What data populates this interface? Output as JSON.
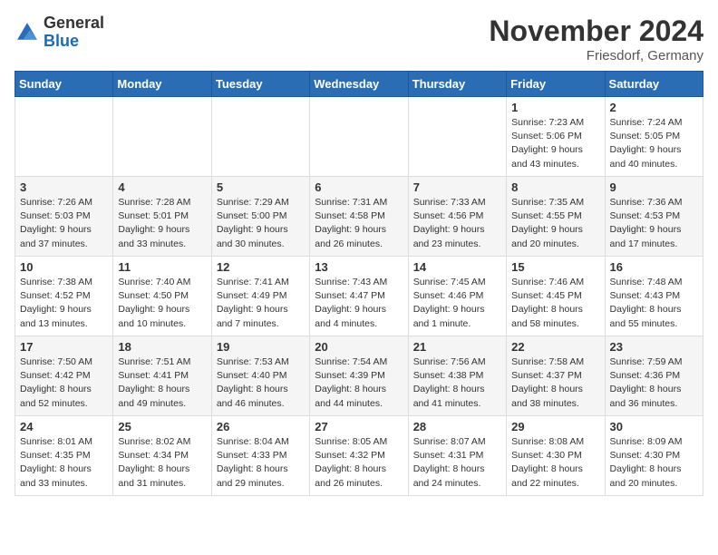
{
  "header": {
    "logo_general": "General",
    "logo_blue": "Blue",
    "month_title": "November 2024",
    "location": "Friesdorf, Germany"
  },
  "days_of_week": [
    "Sunday",
    "Monday",
    "Tuesday",
    "Wednesday",
    "Thursday",
    "Friday",
    "Saturday"
  ],
  "weeks": [
    [
      {
        "day": "",
        "info": ""
      },
      {
        "day": "",
        "info": ""
      },
      {
        "day": "",
        "info": ""
      },
      {
        "day": "",
        "info": ""
      },
      {
        "day": "",
        "info": ""
      },
      {
        "day": "1",
        "info": "Sunrise: 7:23 AM\nSunset: 5:06 PM\nDaylight: 9 hours\nand 43 minutes."
      },
      {
        "day": "2",
        "info": "Sunrise: 7:24 AM\nSunset: 5:05 PM\nDaylight: 9 hours\nand 40 minutes."
      }
    ],
    [
      {
        "day": "3",
        "info": "Sunrise: 7:26 AM\nSunset: 5:03 PM\nDaylight: 9 hours\nand 37 minutes."
      },
      {
        "day": "4",
        "info": "Sunrise: 7:28 AM\nSunset: 5:01 PM\nDaylight: 9 hours\nand 33 minutes."
      },
      {
        "day": "5",
        "info": "Sunrise: 7:29 AM\nSunset: 5:00 PM\nDaylight: 9 hours\nand 30 minutes."
      },
      {
        "day": "6",
        "info": "Sunrise: 7:31 AM\nSunset: 4:58 PM\nDaylight: 9 hours\nand 26 minutes."
      },
      {
        "day": "7",
        "info": "Sunrise: 7:33 AM\nSunset: 4:56 PM\nDaylight: 9 hours\nand 23 minutes."
      },
      {
        "day": "8",
        "info": "Sunrise: 7:35 AM\nSunset: 4:55 PM\nDaylight: 9 hours\nand 20 minutes."
      },
      {
        "day": "9",
        "info": "Sunrise: 7:36 AM\nSunset: 4:53 PM\nDaylight: 9 hours\nand 17 minutes."
      }
    ],
    [
      {
        "day": "10",
        "info": "Sunrise: 7:38 AM\nSunset: 4:52 PM\nDaylight: 9 hours\nand 13 minutes."
      },
      {
        "day": "11",
        "info": "Sunrise: 7:40 AM\nSunset: 4:50 PM\nDaylight: 9 hours\nand 10 minutes."
      },
      {
        "day": "12",
        "info": "Sunrise: 7:41 AM\nSunset: 4:49 PM\nDaylight: 9 hours\nand 7 minutes."
      },
      {
        "day": "13",
        "info": "Sunrise: 7:43 AM\nSunset: 4:47 PM\nDaylight: 9 hours\nand 4 minutes."
      },
      {
        "day": "14",
        "info": "Sunrise: 7:45 AM\nSunset: 4:46 PM\nDaylight: 9 hours\nand 1 minute."
      },
      {
        "day": "15",
        "info": "Sunrise: 7:46 AM\nSunset: 4:45 PM\nDaylight: 8 hours\nand 58 minutes."
      },
      {
        "day": "16",
        "info": "Sunrise: 7:48 AM\nSunset: 4:43 PM\nDaylight: 8 hours\nand 55 minutes."
      }
    ],
    [
      {
        "day": "17",
        "info": "Sunrise: 7:50 AM\nSunset: 4:42 PM\nDaylight: 8 hours\nand 52 minutes."
      },
      {
        "day": "18",
        "info": "Sunrise: 7:51 AM\nSunset: 4:41 PM\nDaylight: 8 hours\nand 49 minutes."
      },
      {
        "day": "19",
        "info": "Sunrise: 7:53 AM\nSunset: 4:40 PM\nDaylight: 8 hours\nand 46 minutes."
      },
      {
        "day": "20",
        "info": "Sunrise: 7:54 AM\nSunset: 4:39 PM\nDaylight: 8 hours\nand 44 minutes."
      },
      {
        "day": "21",
        "info": "Sunrise: 7:56 AM\nSunset: 4:38 PM\nDaylight: 8 hours\nand 41 minutes."
      },
      {
        "day": "22",
        "info": "Sunrise: 7:58 AM\nSunset: 4:37 PM\nDaylight: 8 hours\nand 38 minutes."
      },
      {
        "day": "23",
        "info": "Sunrise: 7:59 AM\nSunset: 4:36 PM\nDaylight: 8 hours\nand 36 minutes."
      }
    ],
    [
      {
        "day": "24",
        "info": "Sunrise: 8:01 AM\nSunset: 4:35 PM\nDaylight: 8 hours\nand 33 minutes."
      },
      {
        "day": "25",
        "info": "Sunrise: 8:02 AM\nSunset: 4:34 PM\nDaylight: 8 hours\nand 31 minutes."
      },
      {
        "day": "26",
        "info": "Sunrise: 8:04 AM\nSunset: 4:33 PM\nDaylight: 8 hours\nand 29 minutes."
      },
      {
        "day": "27",
        "info": "Sunrise: 8:05 AM\nSunset: 4:32 PM\nDaylight: 8 hours\nand 26 minutes."
      },
      {
        "day": "28",
        "info": "Sunrise: 8:07 AM\nSunset: 4:31 PM\nDaylight: 8 hours\nand 24 minutes."
      },
      {
        "day": "29",
        "info": "Sunrise: 8:08 AM\nSunset: 4:30 PM\nDaylight: 8 hours\nand 22 minutes."
      },
      {
        "day": "30",
        "info": "Sunrise: 8:09 AM\nSunset: 4:30 PM\nDaylight: 8 hours\nand 20 minutes."
      }
    ]
  ]
}
